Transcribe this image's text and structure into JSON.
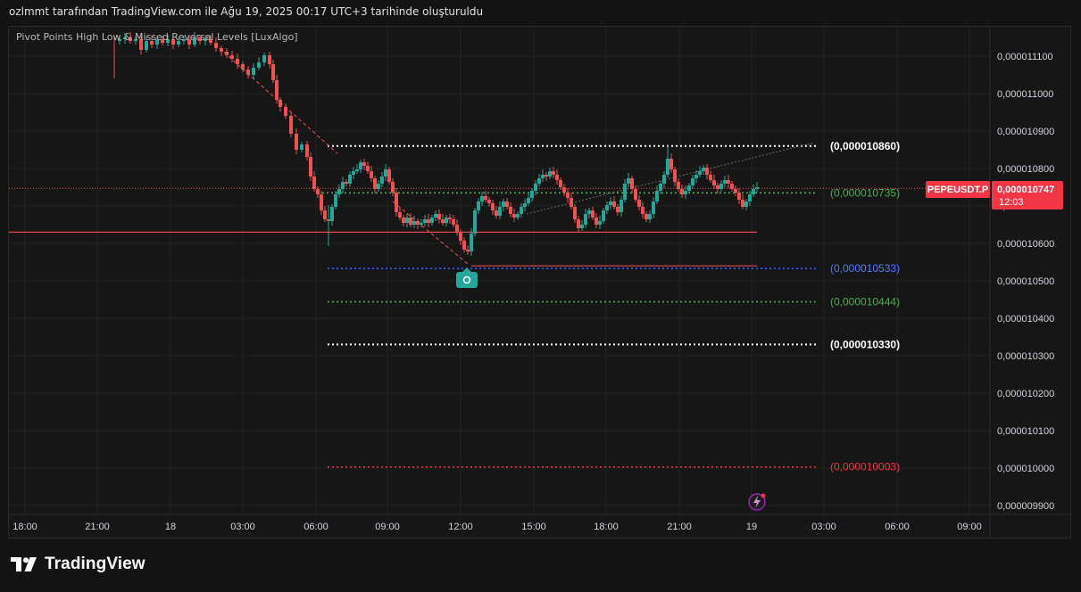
{
  "header": {
    "title": "ozlmmt tarafından TradingView.com ile Ağu 19, 2025 00:17 UTC+3 tarihinde oluşturuldu"
  },
  "indicator": {
    "name": "Pivot Points High Low & Missed Reversal Levels [LuxAlgo]"
  },
  "footer": {
    "brand": "TradingView"
  },
  "colors": {
    "up": "#26a69a",
    "down": "#ef5350",
    "grid": "#232323",
    "axis_text": "#d1d4dc",
    "white_level": "#ffffff",
    "green_level": "#4caf50",
    "blue_level": "#2962ff",
    "red_level": "#f23645"
  },
  "chart_data": {
    "type": "candlestick",
    "symbol": "PEPEUSDT.P",
    "last_price": "0,000010747",
    "countdown": "12:03",
    "y_axis": {
      "min": 9.88e-06,
      "max": 1.122e-05,
      "ticks": [
        {
          "value": 1.11e-05,
          "label": "0,000011100"
        },
        {
          "value": 1.1e-05,
          "label": "0,000011000"
        },
        {
          "value": 1.09e-05,
          "label": "0,000010900"
        },
        {
          "value": 1.08e-05,
          "label": "0,000010800"
        },
        {
          "value": 1.07e-05,
          "label": "0,000010700"
        },
        {
          "value": 1.06e-05,
          "label": "0,000010600"
        },
        {
          "value": 1.05e-05,
          "label": "0,000010500"
        },
        {
          "value": 1.04e-05,
          "label": "0,000010400"
        },
        {
          "value": 1.03e-05,
          "label": "0,000010300"
        },
        {
          "value": 1.02e-05,
          "label": "0,000010200"
        },
        {
          "value": 1.01e-05,
          "label": "0,000010100"
        },
        {
          "value": 1e-05,
          "label": "0,000010000"
        },
        {
          "value": 9.9e-06,
          "label": "0,000009900"
        }
      ]
    },
    "x_axis": {
      "labels": [
        "18:00",
        "21:00",
        "18",
        "03:00",
        "06:00",
        "09:00",
        "12:00",
        "15:00",
        "18:00",
        "21:00",
        "19",
        "03:00",
        "06:00",
        "09:00"
      ]
    },
    "levels": [
      {
        "value": 1.086e-05,
        "label": "(0,000010860)",
        "color": "white",
        "style": "dotted"
      },
      {
        "value": 1.0735e-05,
        "label": "(0,000010735)",
        "color": "green",
        "style": "dotted"
      },
      {
        "value": 1.0533e-05,
        "label": "(0,000010533)",
        "color": "blue",
        "style": "dotted"
      },
      {
        "value": 1.0444e-05,
        "label": "(0,000010444)",
        "color": "green",
        "style": "dotted"
      },
      {
        "value": 1.033e-05,
        "label": "(0,000010330)",
        "color": "white",
        "style": "dotted"
      },
      {
        "value": 1.0003e-05,
        "label": "(0,000010003)",
        "color": "red",
        "style": "dotted"
      }
    ],
    "support_line": 1.063e-05,
    "low_line": 1.054e-05,
    "grid": true
  }
}
